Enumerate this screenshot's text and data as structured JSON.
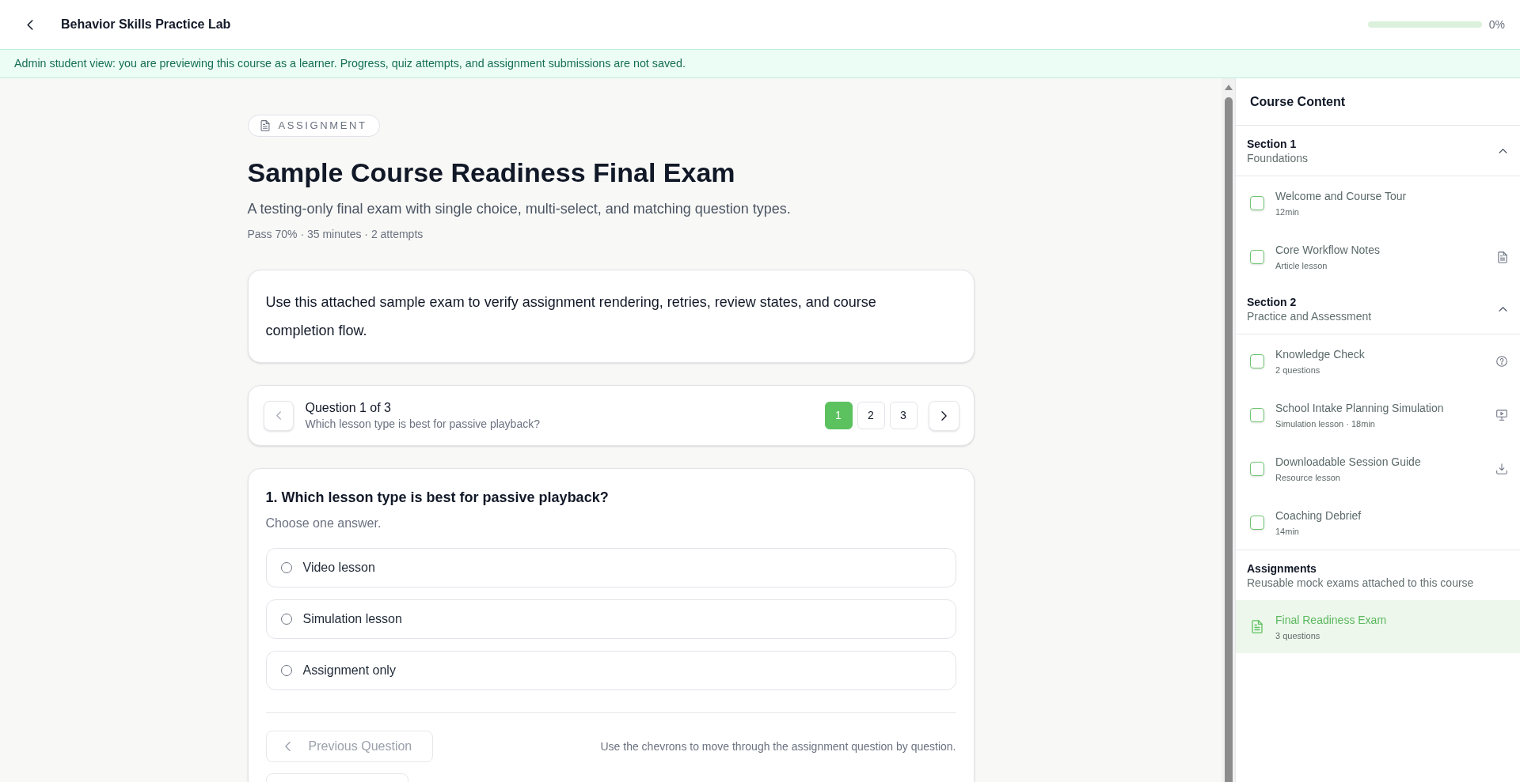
{
  "header": {
    "title": "Behavior Skills Practice Lab",
    "progress": {
      "level": 0,
      "reading": "0%"
    }
  },
  "banner": {
    "text": "Admin student view: you are previewing this course as a learner. Progress, quiz attempts, and assignment submissions are not saved."
  },
  "assignment": {
    "badge": "ASSIGNMENT",
    "title": "Sample Course Readiness Final Exam",
    "subtitle": "A testing-only final exam with single choice, multi-select, and matching question types.",
    "meta": "Pass 70% · 35 minutes · 2 attempts",
    "description": "Use this attached sample exam to verify assignment rendering, retries, review states, and course completion flow."
  },
  "question_nav": {
    "previous_button": {
      "disabled": true
    },
    "heading": "Question 1 of 3",
    "subtitle": "Which lesson type is best for passive playback?",
    "pages": [
      {
        "label": "1",
        "selected": true
      },
      {
        "label": "2",
        "selected": false
      },
      {
        "label": "3",
        "selected": false
      }
    ],
    "next_button": {
      "disabled": false
    }
  },
  "question": {
    "title": "1. Which lesson type is best for passive playback?",
    "instruction": "Choose one answer.",
    "options": [
      {
        "label": "Video lesson",
        "selected": false
      },
      {
        "label": "Simulation lesson",
        "selected": false
      },
      {
        "label": "Assignment only",
        "selected": false
      }
    ],
    "previous_button": {
      "label": "Previous Question",
      "disabled": true
    },
    "hint": "Use the chevrons to move through the assignment question by question."
  },
  "sidebar": {
    "title": "Course Content",
    "sections": [
      {
        "label": "Section 1",
        "subtitle": "Foundations",
        "expanded": true,
        "items": [
          {
            "title": "Welcome and Course Tour",
            "subtitle": "12min",
            "kind": "lesson",
            "checked": false,
            "selected": false
          },
          {
            "title": "Core Workflow Notes",
            "subtitle": "Article lesson",
            "kind": "article",
            "checked": false,
            "selected": false
          }
        ]
      },
      {
        "label": "Section 2",
        "subtitle": "Practice and Assessment",
        "expanded": true,
        "items": [
          {
            "title": "Knowledge Check",
            "subtitle": "2 questions",
            "kind": "quiz",
            "checked": false,
            "selected": false
          },
          {
            "title": "School Intake Planning Simulation",
            "subtitle": "Simulation lesson · 18min",
            "kind": "simulation",
            "checked": false,
            "selected": false
          },
          {
            "title": "Downloadable Session Guide",
            "subtitle": "Resource lesson",
            "kind": "resource",
            "checked": false,
            "selected": false
          },
          {
            "title": "Coaching Debrief",
            "subtitle": "14min",
            "kind": "lesson",
            "checked": false,
            "selected": false
          }
        ]
      }
    ],
    "assignments": {
      "label": "Assignments",
      "subtitle": "Reusable mock exams attached to this course",
      "items": [
        {
          "title": "Final Readiness Exam",
          "subtitle": "3 questions",
          "selected": true
        }
      ]
    }
  }
}
